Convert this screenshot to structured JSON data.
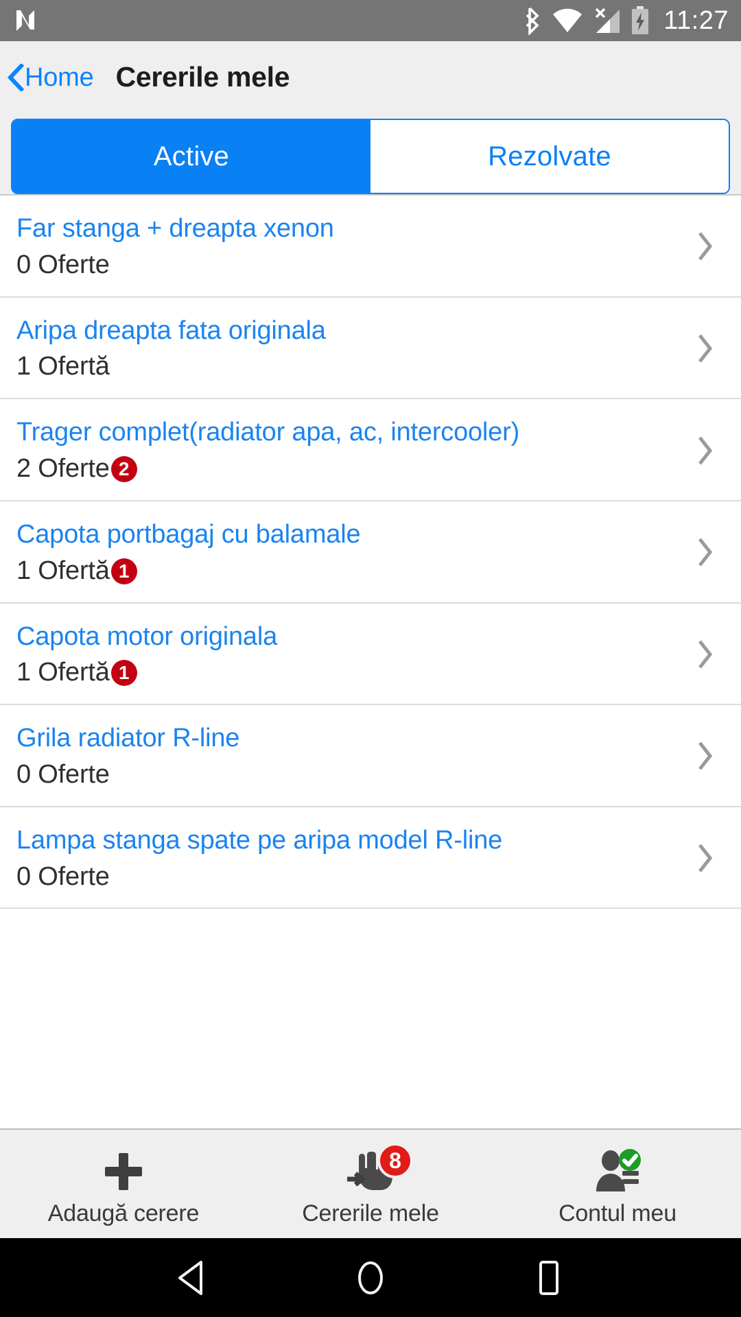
{
  "status_bar": {
    "app_icon": "n-logo-icon",
    "icons": [
      "bluetooth-icon",
      "wifi-icon",
      "cellular-no-sim-icon",
      "battery-charging-icon"
    ],
    "time": "11:27",
    "background_color": "#757575"
  },
  "header": {
    "back_label": "Home",
    "title": "Cererile mele",
    "accent_color": "#0A84FF",
    "background_color": "#EFEFEF"
  },
  "tabs": {
    "selected_index": 0,
    "items": [
      {
        "label": "Active",
        "selected": true
      },
      {
        "label": "Rezolvate",
        "selected": false
      }
    ],
    "accent_color": "#0A80F5"
  },
  "list": {
    "rows": [
      {
        "title": "Far stanga + dreapta xenon",
        "subtitle": "0 Oferte",
        "badge": ""
      },
      {
        "title": "Aripa dreapta fata originala",
        "subtitle": "1 Ofertă",
        "badge": ""
      },
      {
        "title": "Trager complet(radiator apa, ac, intercooler)",
        "subtitle": "2 Oferte",
        "badge": "2"
      },
      {
        "title": "Capota portbagaj cu balamale",
        "subtitle": "1 Ofertă",
        "badge": "1"
      },
      {
        "title": "Capota motor originala",
        "subtitle": "1 Ofertă",
        "badge": "1"
      },
      {
        "title": "Grila radiator R-line",
        "subtitle": "0 Oferte",
        "badge": ""
      },
      {
        "title": "Lampa stanga spate pe aripa model R-line",
        "subtitle": "0 Oferte",
        "badge": ""
      }
    ],
    "title_color": "#1a84f0",
    "badge_color": "#C20012"
  },
  "bottom_bar": {
    "items": [
      {
        "label": "Adaugă cerere",
        "icon": "plus-icon",
        "badge": ""
      },
      {
        "label": "Cererile mele",
        "icon": "hand-request-icon",
        "badge": "8"
      },
      {
        "label": "Contul meu",
        "icon": "user-verified-icon",
        "badge": ""
      }
    ],
    "badge_color": "#E01B18",
    "background_color": "#EFEFEF"
  },
  "android_nav": {
    "buttons": [
      "back-icon",
      "home-icon",
      "recents-icon"
    ],
    "background_color": "#000000"
  }
}
